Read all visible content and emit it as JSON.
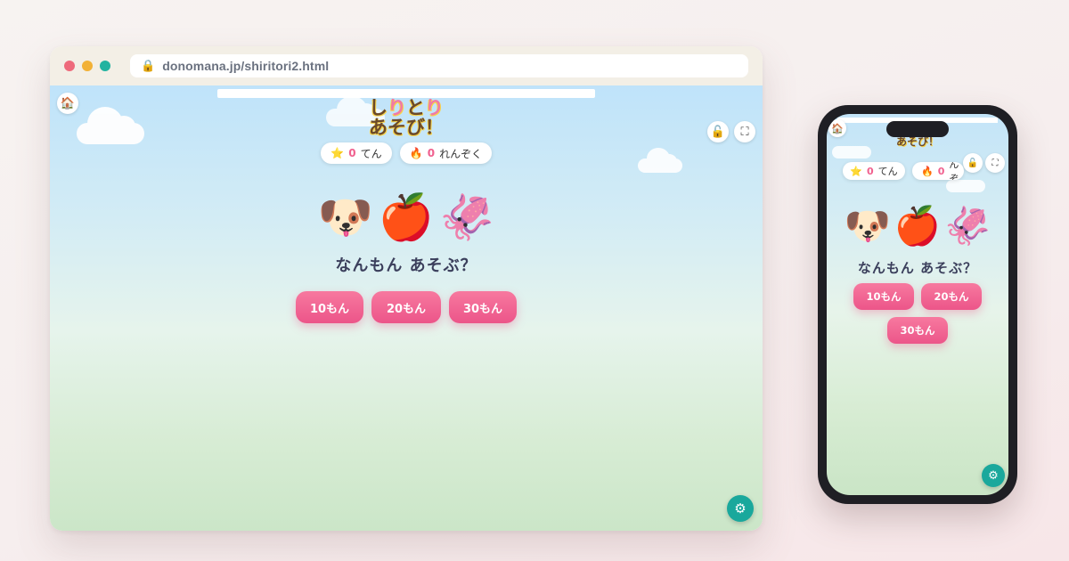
{
  "browser": {
    "url": "donomana.jp/shiritori2.html",
    "lock_icon": "lock-icon",
    "traffic_lights": [
      "#ee6a7b",
      "#f2b136",
      "#22b3a0"
    ]
  },
  "game": {
    "title_line1_a": "し",
    "title_line1_b": "り",
    "title_line1_c": "と",
    "title_line1_d": "り",
    "title_line2": "あそび！",
    "score": {
      "icon": "⭐",
      "value": "0",
      "label": "てん"
    },
    "streak": {
      "icon": "🔥",
      "value": "0",
      "label": "れんぞく"
    },
    "emojis": [
      "🐶",
      "🍎",
      "🦑"
    ],
    "question": "なんもん あそぶ？",
    "mode_buttons": [
      "10もん",
      "20もん",
      "30もん"
    ],
    "icons": {
      "home": "🏠",
      "unlock": "🔓",
      "fullscreen": "⛶",
      "settings": "⚙"
    },
    "accent_pink": "#ec5589",
    "settings_color": "#1aa89c"
  },
  "phone": {
    "title_partial": "あそび！"
  }
}
